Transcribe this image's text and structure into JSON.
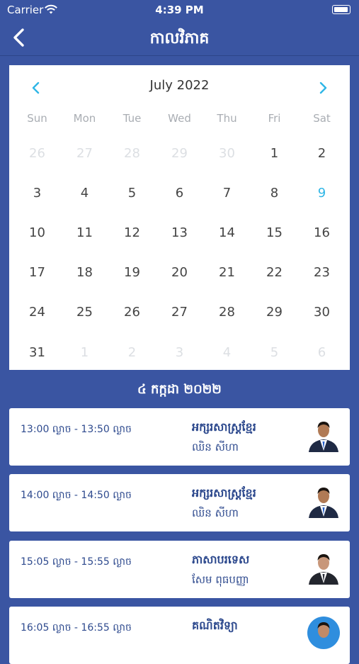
{
  "status_bar": {
    "carrier": "Carrier",
    "time": "4:39 PM"
  },
  "navbar": {
    "title": "កាលវិភាគ"
  },
  "calendar": {
    "month_label": "July 2022",
    "weekdays": [
      "Sun",
      "Mon",
      "Tue",
      "Wed",
      "Thu",
      "Fri",
      "Sat"
    ],
    "selected_day": "9",
    "days": [
      {
        "d": "26",
        "o": true
      },
      {
        "d": "27",
        "o": true
      },
      {
        "d": "28",
        "o": true
      },
      {
        "d": "29",
        "o": true
      },
      {
        "d": "30",
        "o": true
      },
      {
        "d": "1",
        "o": false
      },
      {
        "d": "2",
        "o": false
      },
      {
        "d": "3",
        "o": false
      },
      {
        "d": "4",
        "o": false
      },
      {
        "d": "5",
        "o": false
      },
      {
        "d": "6",
        "o": false
      },
      {
        "d": "7",
        "o": false
      },
      {
        "d": "8",
        "o": false
      },
      {
        "d": "9",
        "o": false
      },
      {
        "d": "10",
        "o": false
      },
      {
        "d": "11",
        "o": false
      },
      {
        "d": "12",
        "o": false
      },
      {
        "d": "13",
        "o": false
      },
      {
        "d": "14",
        "o": false
      },
      {
        "d": "15",
        "o": false
      },
      {
        "d": "16",
        "o": false
      },
      {
        "d": "17",
        "o": false
      },
      {
        "d": "18",
        "o": false
      },
      {
        "d": "19",
        "o": false
      },
      {
        "d": "20",
        "o": false
      },
      {
        "d": "21",
        "o": false
      },
      {
        "d": "22",
        "o": false
      },
      {
        "d": "23",
        "o": false
      },
      {
        "d": "24",
        "o": false
      },
      {
        "d": "25",
        "o": false
      },
      {
        "d": "26",
        "o": false
      },
      {
        "d": "27",
        "o": false
      },
      {
        "d": "28",
        "o": false
      },
      {
        "d": "29",
        "o": false
      },
      {
        "d": "30",
        "o": false
      },
      {
        "d": "31",
        "o": false
      },
      {
        "d": "1",
        "o": true
      },
      {
        "d": "2",
        "o": true
      },
      {
        "d": "3",
        "o": true
      },
      {
        "d": "4",
        "o": true
      },
      {
        "d": "5",
        "o": true
      },
      {
        "d": "6",
        "o": true
      }
    ]
  },
  "schedule": {
    "date_label": "៤ កក្កដា ២០២២",
    "items": [
      {
        "time": "13:00 ល្ងាច  -  13:50 ល្ងាច",
        "subject": "អក្សរសាស្ត្រខ្មែរ",
        "teacher": "ឈិន សីហា"
      },
      {
        "time": "14:00 ល្ងាច  -  14:50 ល្ងាច",
        "subject": "អក្សរសាស្ត្រខ្មែរ",
        "teacher": "ឈិន សីហា"
      },
      {
        "time": "15:05 ល្ងាច  -  15:55 ល្ងាច",
        "subject": "ភាសាបរទេស",
        "teacher": "សែម ពុធបញ្ញា"
      },
      {
        "time": "16:05 ល្ងាច  -  16:55 ល្ងាច",
        "subject": "គណិតវិទ្យា",
        "teacher": ""
      }
    ]
  },
  "colors": {
    "primary": "#3a55a2",
    "accent": "#2fb6e6",
    "text_blue": "#2e4a8e"
  },
  "icons": {
    "back": "chevron-left-icon",
    "prev": "chevron-left-icon",
    "next": "chevron-right-icon",
    "wifi": "wifi-icon",
    "battery": "battery-icon"
  }
}
